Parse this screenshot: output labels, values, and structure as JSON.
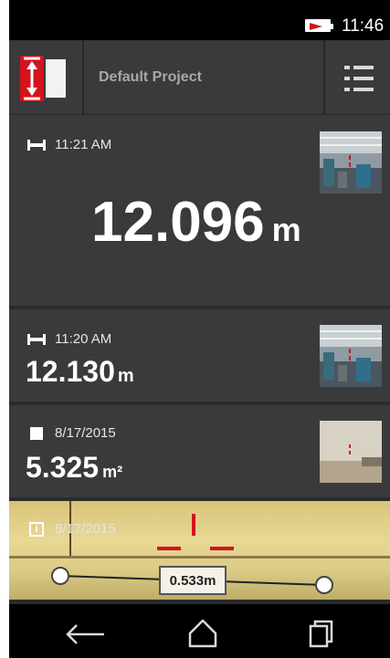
{
  "status_bar": {
    "time": "11:46"
  },
  "header": {
    "project_title": "Default Project"
  },
  "measurements": [
    {
      "type": "distance-icon",
      "time": "11:21 AM",
      "value": "12.096",
      "unit": "m"
    },
    {
      "type": "distance-icon",
      "time": "11:20 AM",
      "value": "12.130",
      "unit": "m"
    },
    {
      "type": "area-icon",
      "time": "8/17/2015",
      "value": "5.325",
      "unit": "m²"
    },
    {
      "type": "info-icon",
      "time": "8/17/2015",
      "photo_label": "0.533m",
      "info_glyph": "i"
    }
  ],
  "nav": {
    "back": "back-icon",
    "home": "home-icon",
    "recents": "recents-icon"
  },
  "colors": {
    "accent": "#d4131d",
    "header": "#3a3a3a",
    "divider": "#2a2a2a"
  }
}
